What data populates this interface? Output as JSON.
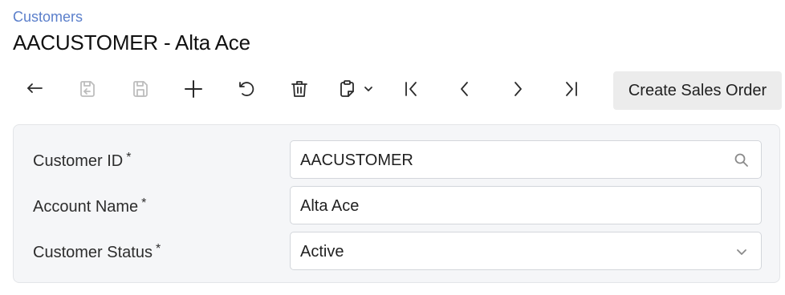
{
  "breadcrumb": "Customers",
  "page_title": "AACUSTOMER - Alta Ace",
  "toolbar": {
    "buttons": [
      {
        "icon": "undo-back-icon",
        "enabled": true
      },
      {
        "icon": "save-close-icon",
        "enabled": false
      },
      {
        "icon": "save-icon",
        "enabled": false
      },
      {
        "icon": "plus-icon",
        "enabled": true
      },
      {
        "icon": "cancel-undo-icon",
        "enabled": true
      },
      {
        "icon": "trash-icon",
        "enabled": true
      },
      {
        "icon": "clipboard-icon",
        "enabled": true
      },
      {
        "icon": "first-record-icon",
        "enabled": true
      },
      {
        "icon": "previous-record-icon",
        "enabled": true
      },
      {
        "icon": "next-record-icon",
        "enabled": true
      },
      {
        "icon": "last-record-icon",
        "enabled": true
      }
    ],
    "create_sales_order_label": "Create Sales Order"
  },
  "form": {
    "customer_id": {
      "label": "Customer ID",
      "required_mark": "*",
      "value": "AACUSTOMER",
      "icon": "search-icon"
    },
    "account_name": {
      "label": "Account Name",
      "required_mark": "*",
      "value": "Alta Ace"
    },
    "customer_status": {
      "label": "Customer Status",
      "required_mark": "*",
      "value": "Active",
      "icon": "chevron-down-icon"
    }
  },
  "colors": {
    "breadcrumb": "#5b7fcb",
    "panel_bg": "#f5f6f8",
    "button_bg": "#ececec",
    "disabled_icon": "#bdbdbd"
  }
}
